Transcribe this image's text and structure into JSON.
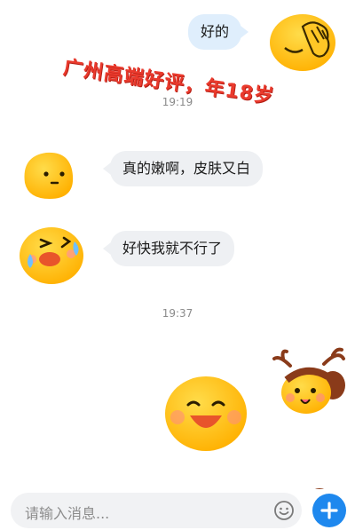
{
  "messages": {
    "m1_text": "好的",
    "m2_text": "真的嫩啊，皮肤又白",
    "m3_text": "好快我就不行了"
  },
  "timestamps": {
    "t1": "19:19",
    "t2": "19:37"
  },
  "overlay_text": "广州高端好评，年18岁",
  "composer": {
    "placeholder": "请输入消息..."
  },
  "icons": {
    "emoji": "smiley-icon",
    "send": "plus-icon"
  },
  "colors": {
    "accent": "#1e88ee",
    "overlay": "#ea3a2d",
    "sticker": "#ffc21a"
  }
}
